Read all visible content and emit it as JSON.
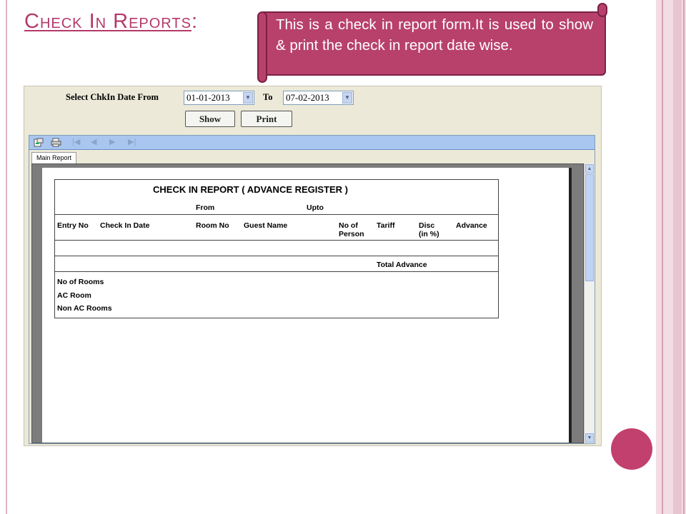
{
  "slide": {
    "title": "Check In Reports",
    "title_suffix": ":",
    "callout": "This is a check in report form.It is used to show & print the check in report date wise."
  },
  "form": {
    "from_label": "Select ChkIn Date From",
    "from_value": "01-01-2013",
    "to_label": "To",
    "to_value": "07-02-2013",
    "show_button": "Show",
    "print_button": "Print"
  },
  "viewer": {
    "toolbar_icons": [
      "export-icon",
      "print-icon",
      "first-page-icon",
      "prev-page-icon",
      "next-page-icon",
      "last-page-icon"
    ],
    "tab": "Main Report"
  },
  "report": {
    "title": "CHECK IN REPORT ( ADVANCE REGISTER )",
    "from_label": "From",
    "upto_label": "Upto",
    "columns": {
      "entry_no": "Entry No",
      "check_in_date": "Check In Date",
      "room_no": "Room No",
      "guest_name": "Guest Name",
      "no_of_person_1": "No of",
      "no_of_person_2": "Person",
      "tariff": "Tariff",
      "disc_1": "Disc",
      "disc_2": "(in %)",
      "advance": "Advance"
    },
    "total_advance": "Total Advance",
    "summary": {
      "no_of_rooms": "No of Rooms",
      "ac_room": "AC Room",
      "non_ac_rooms": "Non AC Rooms"
    }
  },
  "colors": {
    "accent": "#b8416c",
    "title": "#b5386a",
    "toolbar": "#a8c6ef"
  }
}
